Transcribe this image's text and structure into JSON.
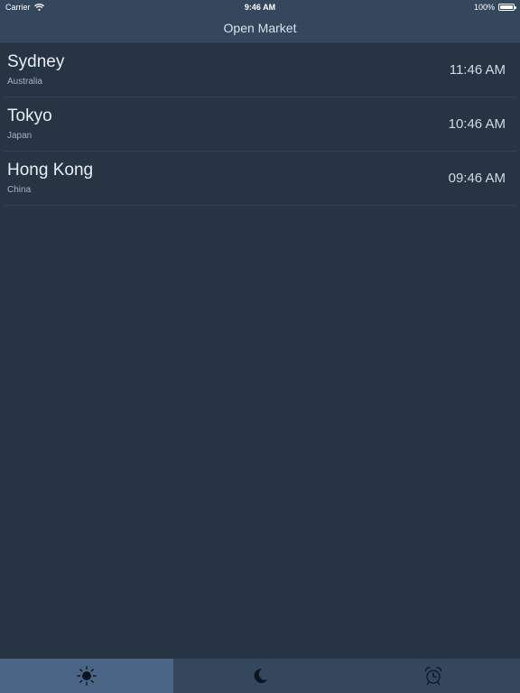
{
  "status_bar": {
    "carrier": "Carrier",
    "time": "9:46 AM",
    "battery": "100%"
  },
  "nav": {
    "title": "Open Market"
  },
  "markets": [
    {
      "city": "Sydney",
      "country": "Australia",
      "time": "11:46 AM"
    },
    {
      "city": "Tokyo",
      "country": "Japan",
      "time": "10:46 AM"
    },
    {
      "city": "Hong Kong",
      "country": "China",
      "time": "09:46 AM"
    }
  ],
  "tabs": [
    {
      "icon": "sun-icon",
      "active": true
    },
    {
      "icon": "moon-icon",
      "active": false
    },
    {
      "icon": "alarm-clock-icon",
      "active": false
    }
  ],
  "colors": {
    "background": "#263444",
    "bar": "#34475c",
    "active_tab": "#4a6585"
  }
}
